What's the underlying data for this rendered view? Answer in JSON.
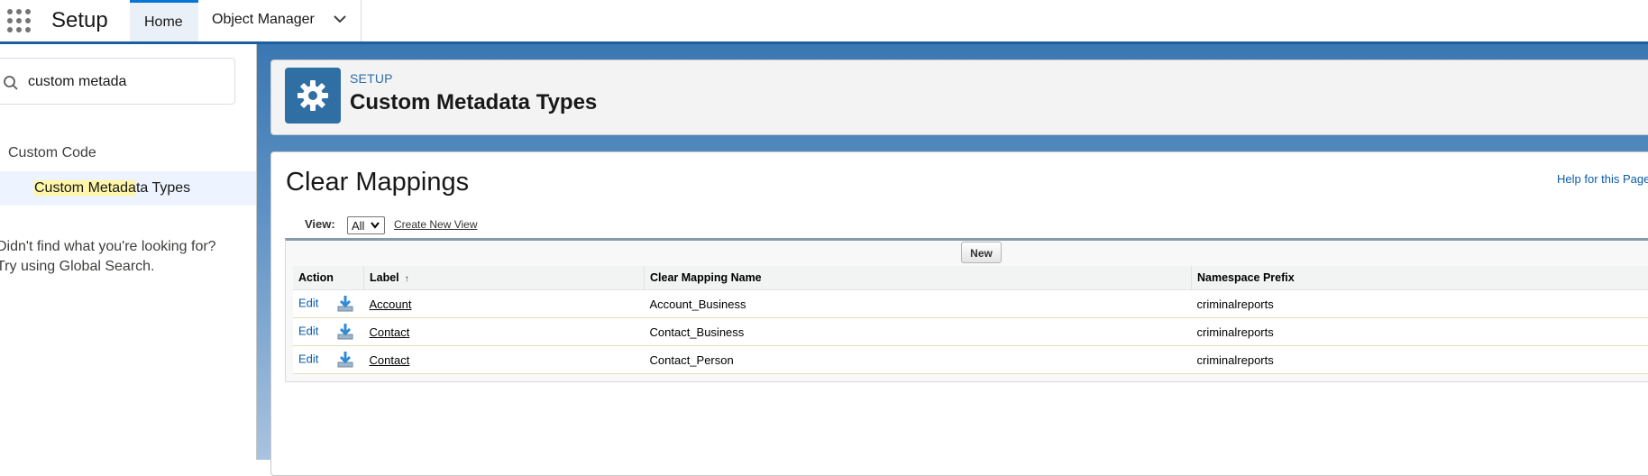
{
  "app": {
    "title": "Setup"
  },
  "tabs": [
    {
      "label": "Home",
      "active": true
    },
    {
      "label": "Object Manager",
      "active": false
    }
  ],
  "sidebar": {
    "search": {
      "value": "custom metada",
      "placeholder": ""
    },
    "group_label": "Custom Code",
    "item": {
      "label_highlight": "Custom Metada",
      "label_rest": "ta Types"
    },
    "not_found_line1": "Didn't find what you're looking for?",
    "not_found_line2": "Try using Global Search."
  },
  "header": {
    "eyebrow": "SETUP",
    "title": "Custom Metadata Types",
    "icon": "gear-icon"
  },
  "list": {
    "title": "Clear Mappings",
    "help_link": "Help for this Page",
    "view_label": "View:",
    "view_selected": "All",
    "create_view": "Create New View",
    "new_button": "New",
    "columns": [
      "Action",
      "Label",
      "Clear Mapping Name",
      "Namespace Prefix"
    ],
    "sort_indicator": "↑",
    "rows": [
      {
        "action": "Edit",
        "label": "Account",
        "name": "Account_Business",
        "prefix": "criminalreports"
      },
      {
        "action": "Edit",
        "label": "Contact",
        "name": "Contact_Business",
        "prefix": "criminalreports"
      },
      {
        "action": "Edit",
        "label": "Contact",
        "name": "Contact_Person",
        "prefix": "criminalreports"
      }
    ]
  },
  "colors": {
    "brand_blue": "#0176d3",
    "header_line": "#1b5f9e",
    "link_blue": "#0b5cab",
    "icon_tile": "#2f6fa4",
    "highlight": "#fff6a8"
  }
}
